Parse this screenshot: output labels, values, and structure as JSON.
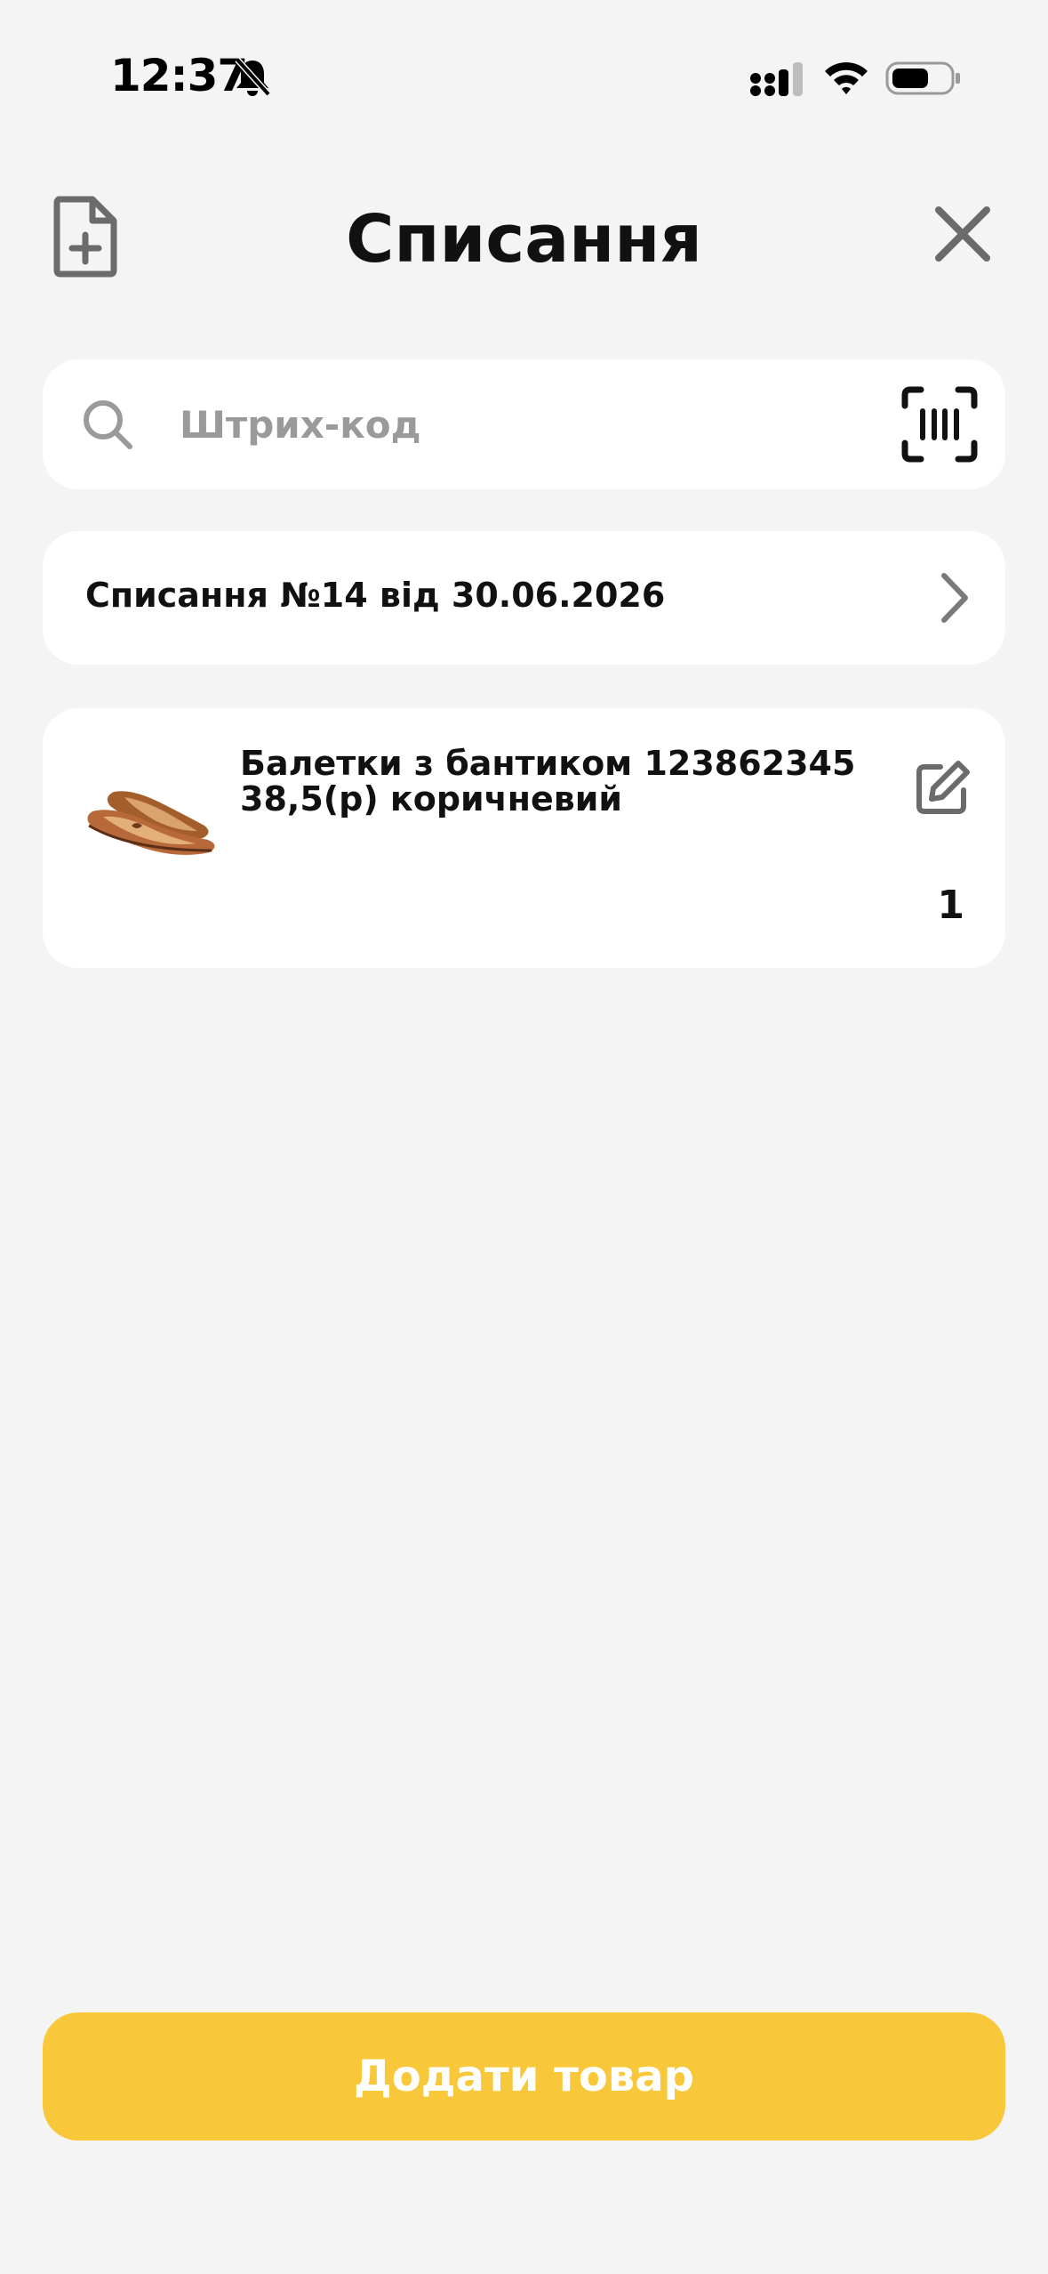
{
  "status_bar": {
    "time": "12:37",
    "icons": [
      "bell-slash-icon",
      "cellular-signal-icon",
      "wifi-icon",
      "battery-icon"
    ]
  },
  "header": {
    "title": "Списання",
    "left_icon": "document-add-icon",
    "right_icon": "close-icon"
  },
  "search": {
    "placeholder": "Штрих-код",
    "value": "",
    "left_icon": "search-icon",
    "right_icon": "barcode-scan-icon"
  },
  "document": {
    "label": "Списання №14 від 30.06.2026",
    "icon": "chevron-right-icon"
  },
  "items": [
    {
      "name": "Балетки з бантиком 123862345 38,5(р) коричневий",
      "quantity": "1",
      "image": "brown-ballet-flats-image",
      "action_icon": "edit-icon"
    }
  ],
  "footer": {
    "add_button_label": "Додати товар"
  },
  "colors": {
    "background": "#f4f4f4",
    "card": "#ffffff",
    "accent": "#f9c83a",
    "icon_gray": "#6b6b6b",
    "placeholder": "#9a9a9a"
  }
}
